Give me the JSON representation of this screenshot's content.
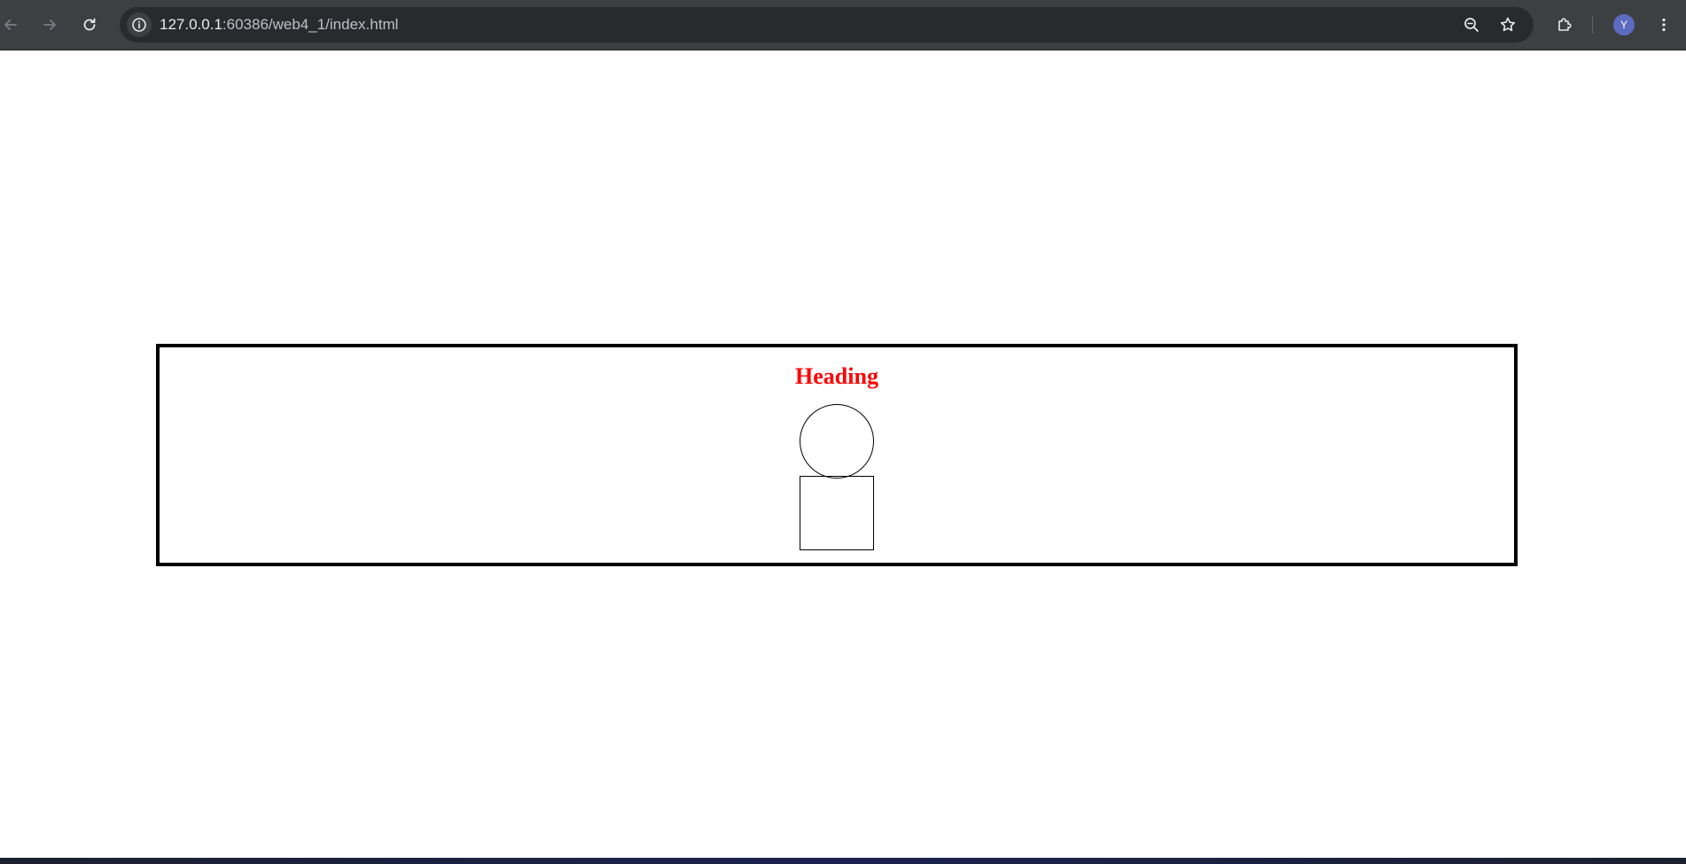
{
  "browser": {
    "url_host": "127.0.0.1",
    "url_rest": ":60386/web4_1/index.html",
    "profile_initial": "Y",
    "icons": {
      "back": "arrow-left-icon",
      "forward": "arrow-right-icon",
      "reload": "reload-icon",
      "site_info": "info-icon",
      "zoom": "zoom-out-icon",
      "bookmark": "star-icon",
      "extensions": "puzzle-icon",
      "menu": "kebab-menu-icon"
    },
    "colors": {
      "toolbar": "#3c4043",
      "omnibox": "#282a2d",
      "avatar": "#5c6bc0"
    }
  },
  "page": {
    "heading": "Heading",
    "colors": {
      "heading": "#ff0000",
      "frame_border": "#000000",
      "shape_stroke": "#000000"
    }
  }
}
